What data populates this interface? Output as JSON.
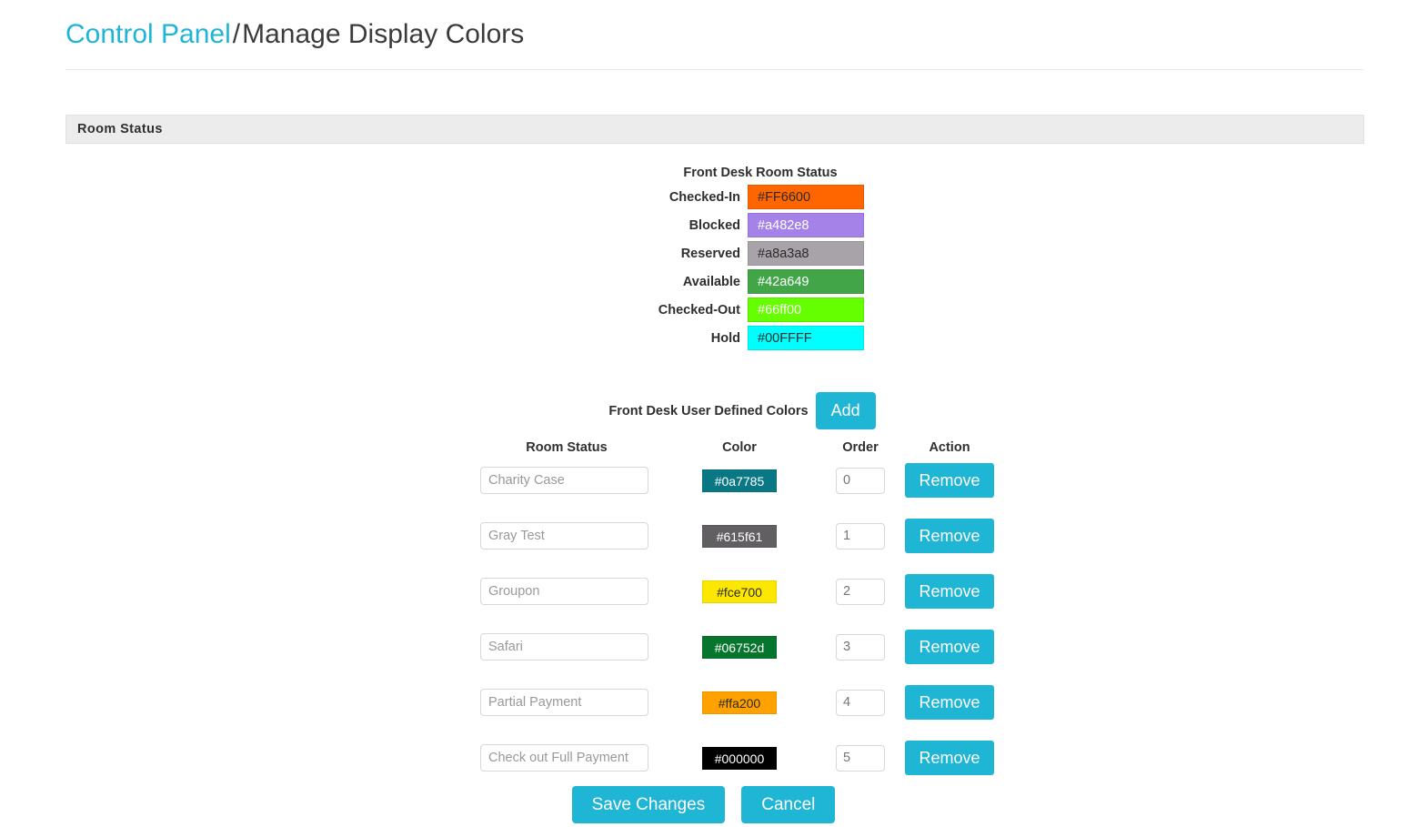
{
  "breadcrumb": {
    "parent": "Control Panel",
    "separator": "/",
    "current": "Manage Display Colors"
  },
  "panel": {
    "heading": "Room Status"
  },
  "builtin": {
    "title": "Front Desk Room Status",
    "rows": [
      {
        "label": "Checked-In",
        "value": "#FF6600",
        "bg": "#FF6600",
        "fg": "#2b2b2b"
      },
      {
        "label": "Blocked",
        "value": "#a482e8",
        "bg": "#a482e8",
        "fg": "#ffffff"
      },
      {
        "label": "Reserved",
        "value": "#a8a3a8",
        "bg": "#a8a3a8",
        "fg": "#2b2b2b"
      },
      {
        "label": "Available",
        "value": "#42a649",
        "bg": "#42a649",
        "fg": "#ffffff"
      },
      {
        "label": "Checked-Out",
        "value": "#66ff00",
        "bg": "#66ff00",
        "fg": "#ffffff"
      },
      {
        "label": "Hold",
        "value": "#00FFFF",
        "bg": "#00FFFF",
        "fg": "#2b2b2b"
      }
    ]
  },
  "user_defined": {
    "title": "Front Desk User Defined Colors",
    "add_label": "Add",
    "columns": {
      "name": "Room Status",
      "color": "Color",
      "order": "Order",
      "action": "Action"
    },
    "rows": [
      {
        "name": "Charity Case",
        "color": "#0a7785",
        "bg": "#0a7785",
        "fg": "#ffffff",
        "order": "0",
        "action": "Remove"
      },
      {
        "name": "Gray Test",
        "color": "#615f61",
        "bg": "#615f61",
        "fg": "#ffffff",
        "order": "1",
        "action": "Remove"
      },
      {
        "name": "Groupon",
        "color": "#fce700",
        "bg": "#fce700",
        "fg": "#2b2b2b",
        "order": "2",
        "action": "Remove"
      },
      {
        "name": "Safari",
        "color": "#06752d",
        "bg": "#06752d",
        "fg": "#ffffff",
        "order": "3",
        "action": "Remove"
      },
      {
        "name": "Partial Payment",
        "color": "#ffa200",
        "bg": "#ffa200",
        "fg": "#2b2b2b",
        "order": "4",
        "action": "Remove"
      },
      {
        "name": "Check out Full Payment",
        "color": "#000000",
        "bg": "#000000",
        "fg": "#ffffff",
        "order": "5",
        "action": "Remove"
      }
    ]
  },
  "footer": {
    "save_label": "Save Changes",
    "cancel_label": "Cancel"
  },
  "theme": {
    "accent": "#1fb5d4",
    "link": "#1fb5d4",
    "panel_header_bg": "#ececec",
    "text": "#3b3b3b"
  }
}
